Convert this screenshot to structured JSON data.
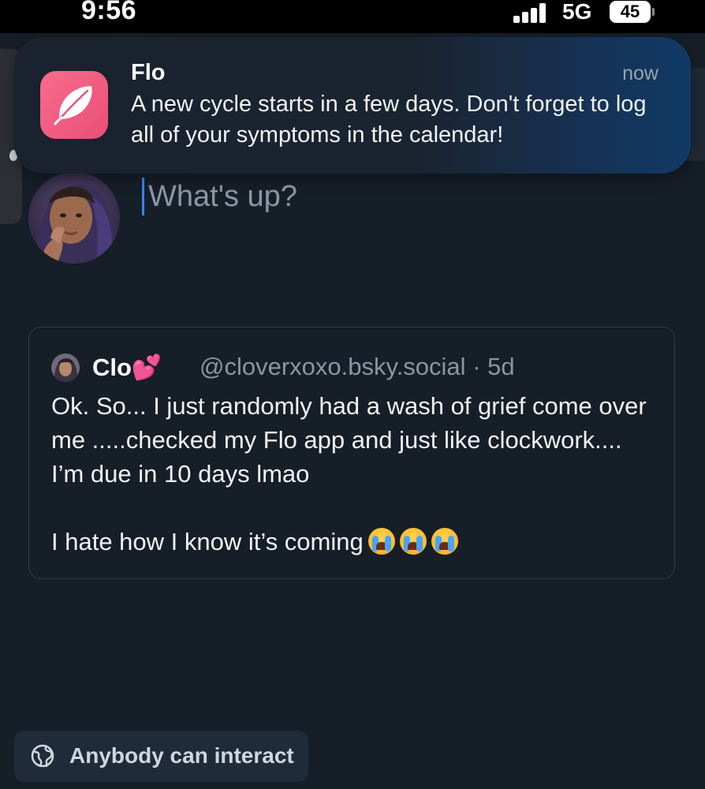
{
  "status_bar": {
    "time": "9:56",
    "network": "5G",
    "battery": "45",
    "signal_icon": "cellular-signal-icon"
  },
  "notification": {
    "app_name": "Flo",
    "time": "now",
    "message": "A new cycle starts in a few days. Don't forget to log all of your symptoms in the calendar!",
    "icon": "feather-icon",
    "icon_color": "#f2607f"
  },
  "compose": {
    "placeholder": "What's up?",
    "avatar": "user-avatar"
  },
  "quoted_post": {
    "display_name": "Clo💕",
    "handle": "@cloverxoxo.bsky.social",
    "separator": "·",
    "age": "5d",
    "text": "Ok. So... I just randomly had a wash of grief come over me .....checked my Flo app and just like clockwork.... I’m due in 10 days lmao\n\nI hate how I know it’s coming",
    "emoji_count": 3,
    "emoji": "loudly-crying-face"
  },
  "interaction_setting": {
    "label": "Anybody can interact",
    "icon": "globe-icon"
  },
  "colors": {
    "background": "#161e27",
    "accent": "#3b82f6",
    "muted_text": "#8a96a3",
    "card_border": "#2f3b48"
  }
}
